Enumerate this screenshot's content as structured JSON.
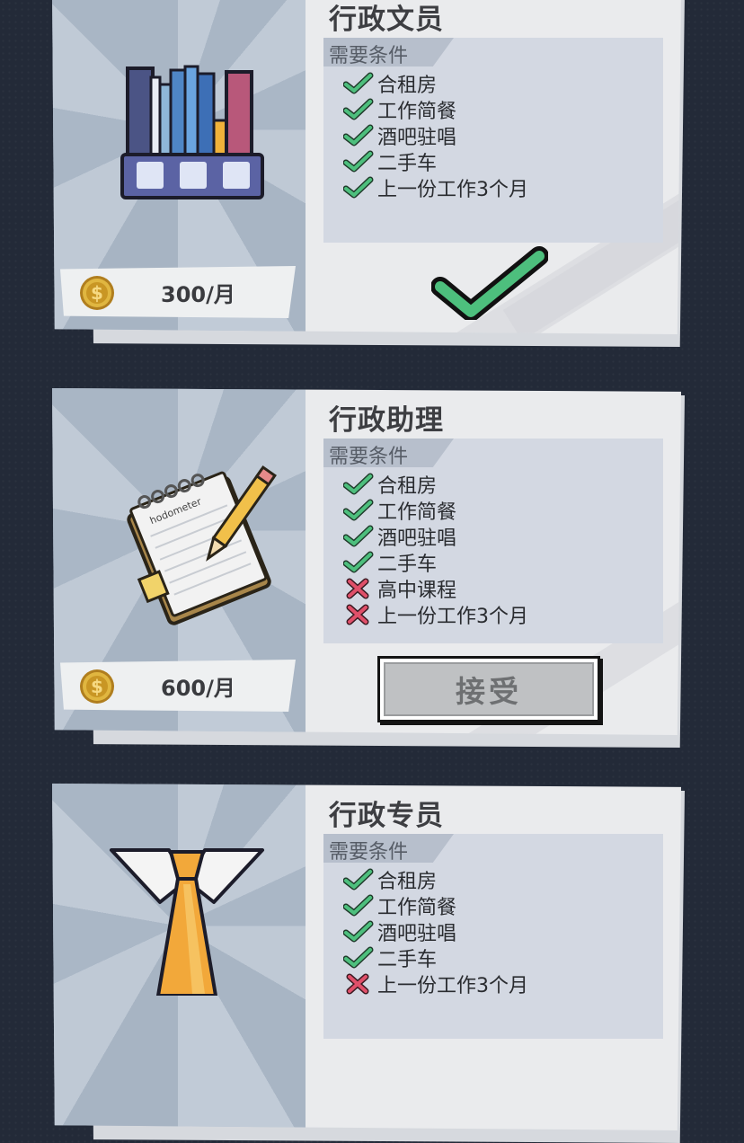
{
  "req_heading": "需要条件",
  "jobs": [
    {
      "title": "行政文员",
      "salary": "300/月",
      "illustration": "file-organizer-books",
      "requirements": [
        {
          "label": "合租房",
          "met": true
        },
        {
          "label": "工作简餐",
          "met": true
        },
        {
          "label": "酒吧驻唱",
          "met": true
        },
        {
          "label": "二手车",
          "met": true
        },
        {
          "label": "上一份工作3个月",
          "met": true
        }
      ],
      "status": "accepted-check"
    },
    {
      "title": "行政助理",
      "salary": "600/月",
      "illustration": "notepad-pencil",
      "notepad_text": "hodometer",
      "requirements": [
        {
          "label": "合租房",
          "met": true
        },
        {
          "label": "工作简餐",
          "met": true
        },
        {
          "label": "酒吧驻唱",
          "met": true
        },
        {
          "label": "二手车",
          "met": true
        },
        {
          "label": "高中课程",
          "met": false
        },
        {
          "label": "上一份工作3个月",
          "met": false
        }
      ],
      "status": "accept-button",
      "accept_label": "接受"
    },
    {
      "title": "行政专员",
      "illustration": "collar-tie",
      "requirements": [
        {
          "label": "合租房",
          "met": true
        },
        {
          "label": "工作简餐",
          "met": true
        },
        {
          "label": "酒吧驻唱",
          "met": true
        },
        {
          "label": "二手车",
          "met": true
        },
        {
          "label": "上一份工作3个月",
          "met": false
        }
      ]
    }
  ],
  "colors": {
    "check": "#4dbf7d",
    "cross": "#e0506a",
    "coin": "#e0b640"
  }
}
